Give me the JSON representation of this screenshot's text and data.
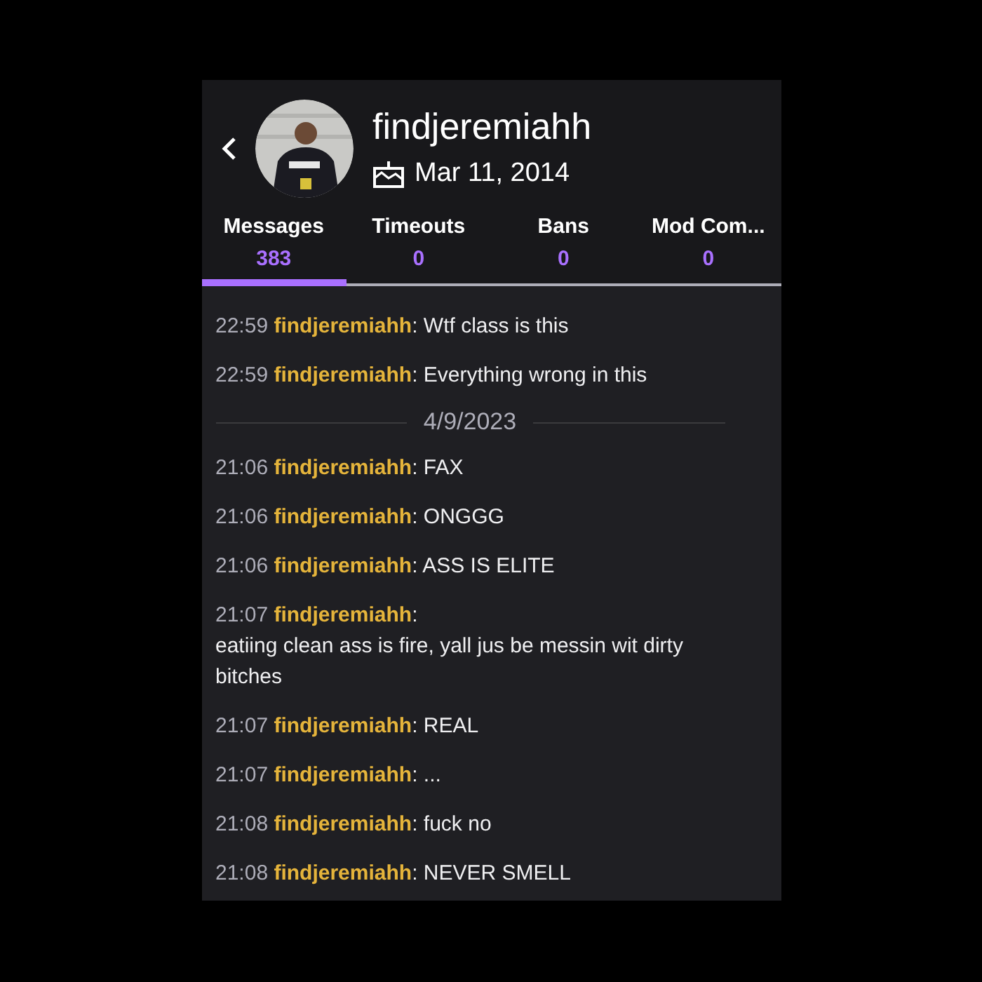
{
  "header": {
    "username": "findjeremiahh",
    "created": "Mar 11, 2014"
  },
  "tabs": [
    {
      "label": "Messages",
      "count": "383",
      "selected": true
    },
    {
      "label": "Timeouts",
      "count": "0",
      "selected": false
    },
    {
      "label": "Bans",
      "count": "0",
      "selected": false
    },
    {
      "label": "Mod Com...",
      "count": "0",
      "selected": false
    }
  ],
  "log": [
    {
      "kind": "message",
      "time": "22:59",
      "user": "findjeremiahh",
      "separator": ":",
      "text": "Wtf class is this"
    },
    {
      "kind": "message",
      "time": "22:59",
      "user": "findjeremiahh",
      "separator": ":",
      "text": "Everything wrong in this"
    },
    {
      "kind": "date",
      "text": "4/9/2023"
    },
    {
      "kind": "message",
      "time": "21:06",
      "user": "findjeremiahh",
      "separator": ":",
      "text": "FAX"
    },
    {
      "kind": "message",
      "time": "21:06",
      "user": "findjeremiahh",
      "separator": ":",
      "text": "ONGGG"
    },
    {
      "kind": "message",
      "time": "21:06",
      "user": "findjeremiahh",
      "separator": ":",
      "text": "ASS IS ELITE"
    },
    {
      "kind": "block",
      "time": "21:07",
      "user": "findjeremiahh",
      "separator": ":",
      "text": "eatiing clean ass is fire, yall jus be messin wit dirty bitches"
    },
    {
      "kind": "message",
      "time": "21:07",
      "user": "findjeremiahh",
      "separator": ":",
      "text": "REAL"
    },
    {
      "kind": "message",
      "time": "21:07",
      "user": "findjeremiahh",
      "separator": ":",
      "text": "..."
    },
    {
      "kind": "message",
      "time": "21:08",
      "user": "findjeremiahh",
      "separator": ":",
      "text": "fuck no"
    },
    {
      "kind": "message",
      "time": "21:08",
      "user": "findjeremiahh",
      "separator": ":",
      "text": "NEVER SMELL"
    }
  ]
}
